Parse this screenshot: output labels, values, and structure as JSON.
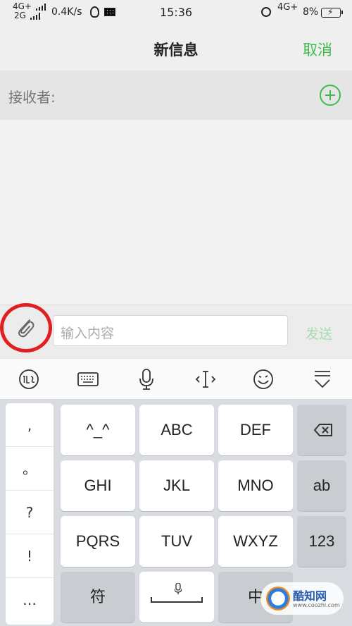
{
  "status_bar": {
    "sim1_network": "4G+",
    "sim2_network": "2G",
    "net_speed": "0.4K/s",
    "time": "15:36",
    "network_right": "4G+",
    "battery_percent": "8%"
  },
  "nav": {
    "title": "新信息",
    "cancel_label": "取消"
  },
  "recipient": {
    "label": "接收者:"
  },
  "composer": {
    "placeholder": "输入内容",
    "send_label": "发送"
  },
  "toolbar": {
    "icons": [
      "handwriting-icon",
      "keyboard-icon",
      "microphone-icon",
      "cursor-icon",
      "emoji-icon",
      "collapse-keyboard-icon"
    ]
  },
  "keyboard": {
    "punctuation": [
      ",",
      "。",
      "?",
      "!",
      "…"
    ],
    "keys": {
      "k1": "^_^",
      "k2": "ABC",
      "k3": "DEF",
      "k4": "GHI",
      "k5": "JKL",
      "k6": "MNO",
      "k7": "PQRS",
      "k8": "TUV",
      "k9": "WXYZ",
      "ab": "ab",
      "num": "123",
      "symbol": "符",
      "chinese": "中"
    }
  },
  "watermark": {
    "name": "酷知网",
    "url": "www.coozhi.com"
  },
  "colors": {
    "accent_green": "#3bbf4a",
    "annotation_red": "#e02020"
  }
}
